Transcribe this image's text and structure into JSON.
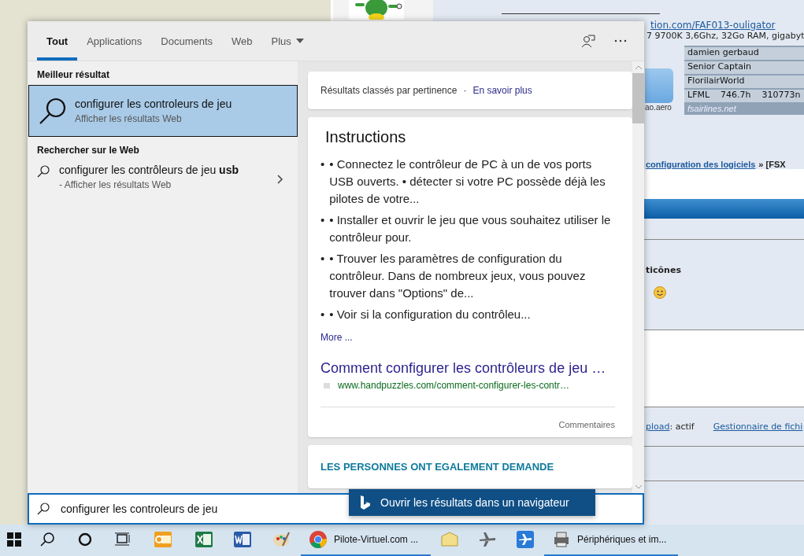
{
  "background_page": {
    "profile_link": "tion.com/FAF013-ouligator",
    "specs": "7 9700K 3,6Ghz, 32Go RAM, gigabyt",
    "tile_caption": "ao.aero",
    "banner": {
      "rows": [
        "damien gerbaud",
        "Senior Captain",
        "FlorilairWorld"
      ],
      "stats": [
        "LFML",
        "746.7h",
        "310773n"
      ],
      "footer": "fsairlines.net"
    },
    "breadcrumb_link": "configuration des logiciels",
    "breadcrumb_rest": "» [FSX",
    "smileys_label": "ticônes",
    "upload_link": "pload",
    "upload_status": ": actif",
    "file_manager_link": "Gestionnaire de fichi"
  },
  "search_panel": {
    "tabs": [
      {
        "label": "Tout",
        "selected": true,
        "dropdown": false
      },
      {
        "label": "Applications",
        "selected": false,
        "dropdown": false
      },
      {
        "label": "Documents",
        "selected": false,
        "dropdown": false
      },
      {
        "label": "Web",
        "selected": false,
        "dropdown": false
      },
      {
        "label": "Plus",
        "selected": false,
        "dropdown": true
      }
    ],
    "best_match": {
      "heading": "Meilleur résultat",
      "title": "configurer les controleurs de jeu",
      "subtitle": "Afficher les résultats Web",
      "selected": true
    },
    "web_section": {
      "heading": "Rechercher sur le Web",
      "items": [
        {
          "title": "configurer les contrôleurs de jeu **usb**",
          "subtitle": "- Afficher les résultats Web"
        }
      ]
    },
    "preview": {
      "ranking_note": "Résultats classés par pertinence",
      "separator": "·",
      "learn_more": "En savoir plus",
      "instructions": {
        "title": "Instructions",
        "items": [
          {
            "marker": "•",
            "text": "• Connectez le contrôleur de PC à un de vos ports USB ouverts. • détecter si votre PC possède déjà les pilotes de votre..."
          },
          {
            "marker": "•",
            "text": "• Installer et ouvrir le jeu que vous souhaitez utiliser le contrôleur pour."
          },
          {
            "marker": "•",
            "text": "• Trouver les paramètres de configuration du contrôleur. Dans de nombreux jeux, vous pouvez trouver dans \"Options\" de..."
          },
          {
            "marker": "•",
            "text": "• Voir si la configuration du contrôleu..."
          }
        ],
        "more": "More ...",
        "source_title": "Comment configurer les contrôleurs de jeu …",
        "source_url": "www.handpuzzles.com/comment-configurer-les-contr…",
        "feedback": "Commentaires"
      },
      "related_heading": "LES PERSONNES ONT EGALEMENT DEMANDE",
      "open_button": "Ouvrir les résultats dans un navigateur"
    },
    "search_box": {
      "value": "configurer les controleurs de jeu"
    }
  },
  "taskbar": {
    "items": [
      {
        "kind": "start",
        "active": false
      },
      {
        "kind": "search",
        "active": false
      },
      {
        "kind": "cortana",
        "active": false
      },
      {
        "kind": "taskview",
        "active": false
      },
      {
        "kind": "outlook",
        "active": false
      },
      {
        "kind": "excel",
        "active": false
      },
      {
        "kind": "word",
        "active": false
      },
      {
        "kind": "paint",
        "active": false
      },
      {
        "kind": "chrome",
        "active": true,
        "label": "Pilote-Virtuel.com ..."
      },
      {
        "kind": "notes",
        "active": false
      },
      {
        "kind": "plane",
        "active": false
      },
      {
        "kind": "flightapp",
        "active": false
      },
      {
        "kind": "devices",
        "active": true,
        "label": "Périphériques et im..."
      }
    ]
  }
}
